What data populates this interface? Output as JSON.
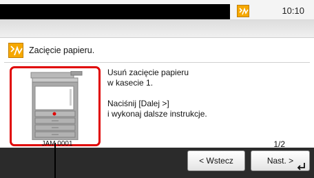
{
  "status_bar": {
    "clock": "10:10",
    "status_icon": "paper-jam-icon"
  },
  "message": {
    "icon": "paper-jam-icon",
    "title": "Zacięcie papieru.",
    "instructions": [
      "Usuń zacięcie papieru",
      "w kasecie 1.",
      "",
      "Naciśnij [Dalej >]",
      "i wykonaj dalsze instrukcje."
    ],
    "image_code": "JAM 0001",
    "page_indicator": "1/2"
  },
  "buttons": {
    "back_label": "< Wstecz",
    "next_label": "Nast. >",
    "next_icon": "enter-icon"
  },
  "colors": {
    "highlight": "#e00000",
    "warning": "#f6a800",
    "bar": "#2b2b2b"
  }
}
